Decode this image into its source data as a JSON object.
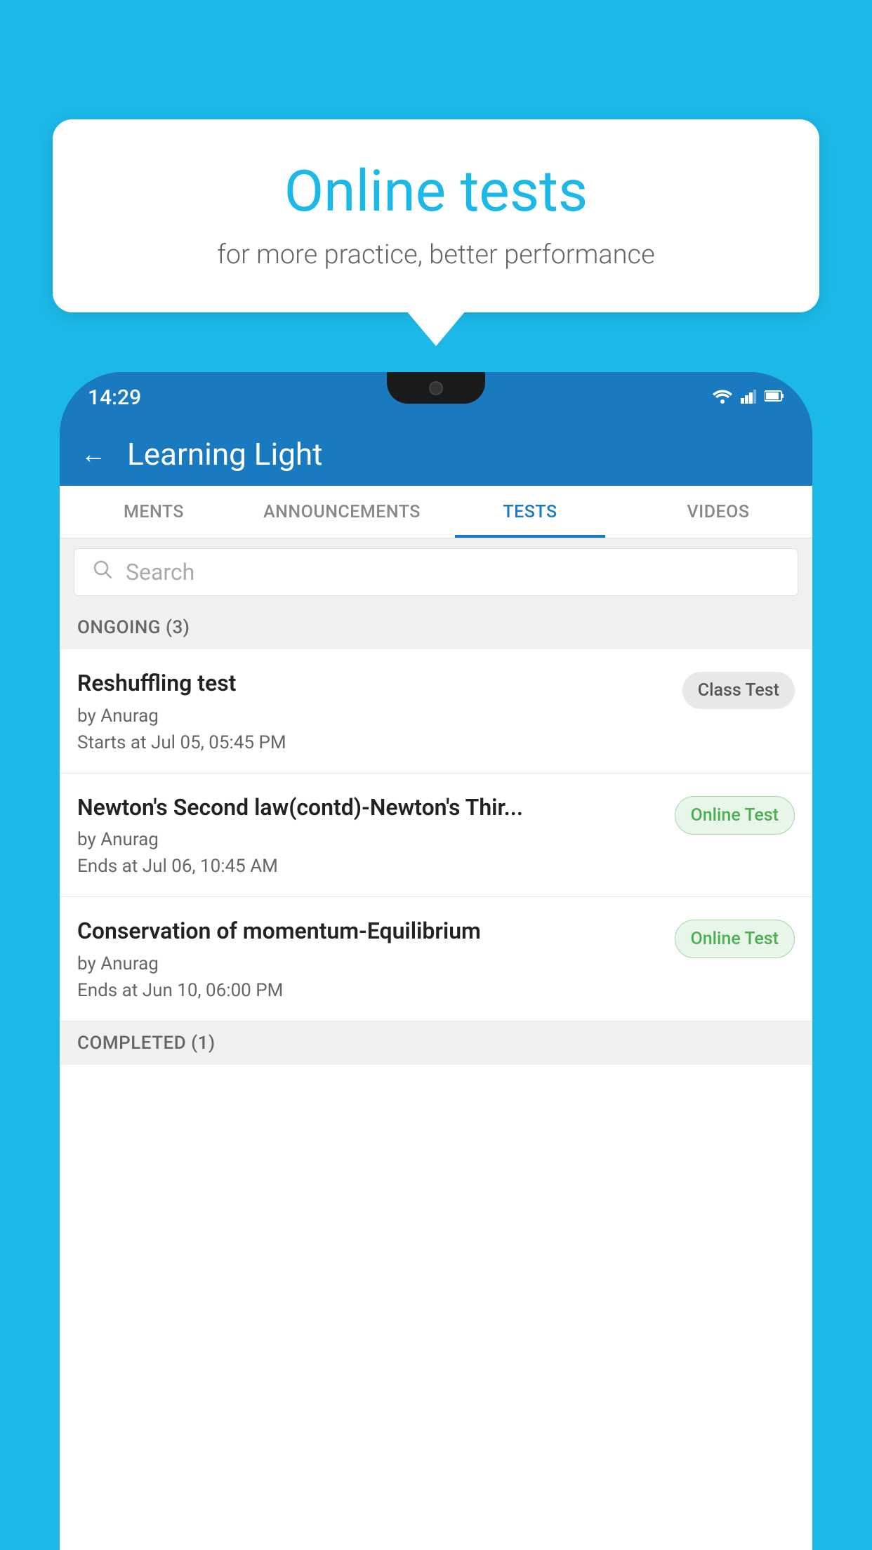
{
  "background": {
    "color": "#1bb8e8"
  },
  "bubble": {
    "title": "Online tests",
    "subtitle": "for more practice, better performance"
  },
  "phone": {
    "statusBar": {
      "time": "14:29",
      "wifiIcon": "▾",
      "signalIcon": "▲",
      "batteryIcon": "▮"
    },
    "header": {
      "backIcon": "←",
      "title": "Learning Light"
    },
    "tabs": [
      {
        "label": "MENTS",
        "active": false
      },
      {
        "label": "ANNOUNCEMENTS",
        "active": false
      },
      {
        "label": "TESTS",
        "active": true
      },
      {
        "label": "VIDEOS",
        "active": false
      }
    ],
    "search": {
      "placeholder": "Search"
    },
    "sections": [
      {
        "label": "ONGOING (3)",
        "items": [
          {
            "name": "Reshuffling test",
            "author": "by Anurag",
            "date": "Starts at  Jul 05, 05:45 PM",
            "badge": "Class Test",
            "badgeType": "class"
          },
          {
            "name": "Newton's Second law(contd)-Newton's Thir...",
            "author": "by Anurag",
            "date": "Ends at  Jul 06, 10:45 AM",
            "badge": "Online Test",
            "badgeType": "online"
          },
          {
            "name": "Conservation of momentum-Equilibrium",
            "author": "by Anurag",
            "date": "Ends at  Jun 10, 06:00 PM",
            "badge": "Online Test",
            "badgeType": "online"
          }
        ]
      },
      {
        "label": "COMPLETED (1)",
        "items": []
      }
    ]
  }
}
